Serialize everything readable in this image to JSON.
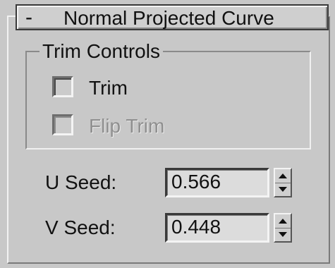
{
  "rollout": {
    "collapse_symbol": "-",
    "title": "Normal Projected Curve"
  },
  "trim_controls": {
    "group_title": "Trim Controls",
    "trim": {
      "label": "Trim",
      "checked": false,
      "enabled": true
    },
    "flip_trim": {
      "label": "Flip Trim",
      "checked": false,
      "enabled": false
    }
  },
  "seeds": {
    "u": {
      "label": "U Seed:",
      "value": "0.566"
    },
    "v": {
      "label": "V Seed:",
      "value": "0.448"
    }
  },
  "colors": {
    "panel_bg": "#c8c8c8",
    "field_bg": "#dcdcdc",
    "disabled_text": "#8f8f8f"
  }
}
